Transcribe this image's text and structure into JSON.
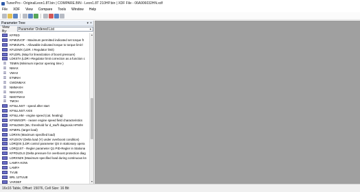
{
  "window": {
    "title": "TunerPro - OriginalLeon1.8T.bin | COMPARE.BIN - Leon1.8T 210HP.bin | XDF File - 06A906032HN.xdf"
  },
  "menu": [
    "File",
    "XDF",
    "View",
    "Compare",
    "Tools",
    "Window",
    "Help"
  ],
  "toolbar": {
    "icons": [
      "new-icon",
      "open-icon",
      "save-icon",
      "compare-icon",
      "xdf-icon",
      "refresh-icon",
      "edit-icon",
      "check-icon",
      "chart-icon",
      "settings-icon"
    ]
  },
  "panel": {
    "title": "Parameter Tree",
    "close": "×",
    "pin": "▾",
    "viewby_label": "View By:",
    "viewby_value": "Parameter Ordered List"
  },
  "tree": {
    "items": [
      {
        "type": "map",
        "label": "KFPED"
      },
      {
        "type": "map",
        "label": "KFMIZUOF - Maximum permitted indicated set torque ft"
      },
      {
        "type": "map",
        "label": "KFMIZUFIL - Allowable indicated torque to torque limit f"
      },
      {
        "type": "map",
        "label": "KFLDIMX (LDR. I Regulator limit)"
      },
      {
        "type": "map",
        "label": "KFLDRL (Map for linearization of boost pressure)"
      },
      {
        "type": "map",
        "label": "LDKSTA (LDR I-Regulator limit correction as a function c"
      },
      {
        "type": "const",
        "label": "TEMIN (Minimum injector opening time )"
      },
      {
        "type": "const",
        "label": "NMAX"
      },
      {
        "type": "const",
        "label": "VMAX"
      },
      {
        "type": "const",
        "label": "ETMNH"
      },
      {
        "type": "const",
        "label": "CWDNMAX"
      },
      {
        "type": "const",
        "label": "NMMAXH"
      },
      {
        "type": "const",
        "label": "NMAXOG"
      },
      {
        "type": "const",
        "label": "NMOTMAX"
      },
      {
        "type": "const",
        "label": "TMOH"
      },
      {
        "type": "map",
        "label": "KFNLLNST - speed after start"
      },
      {
        "type": "map",
        "label": "KFNLLNST AXIS"
      },
      {
        "type": "map",
        "label": "KFNLLHM - engine speed (cat. heating)"
      },
      {
        "type": "map",
        "label": "KFNWSOPI - nearer engine speed field characteristics"
      },
      {
        "type": "map",
        "label": "KFNLDMX (ML: threshold for d_nw/fr diagnosis HFM/H"
      },
      {
        "type": "map",
        "label": "KFMIRL (target load)"
      },
      {
        "type": "map",
        "label": "LDRXN (Maximum specified load)"
      },
      {
        "type": "map",
        "label": "KFLDIOV (Delta load (Y) under overboost condition)"
      },
      {
        "type": "map",
        "label": "LDRQ0S (LDR control parameter QS in stationary opera"
      },
      {
        "type": "map",
        "label": "LDRQ1ST - Regler parameter Q1 PID-Regler in Stationa"
      },
      {
        "type": "map",
        "label": "KFPDLDLS (Delta pressure for overboost protection diag"
      },
      {
        "type": "map",
        "label": "LDRXNZK (Maximum specified load during continuous kn"
      },
      {
        "type": "map",
        "label": "LAMFA-KOW"
      },
      {
        "type": "map",
        "label": "LAMFA"
      },
      {
        "type": "map",
        "label": "TVUB"
      },
      {
        "type": "map",
        "label": "BRL 12TUUB"
      },
      {
        "type": "map",
        "label": "VARDEF"
      }
    ]
  },
  "status": {
    "text": "16x16 Table, Offset: 15076,  Cell Size: 16 Bit"
  }
}
